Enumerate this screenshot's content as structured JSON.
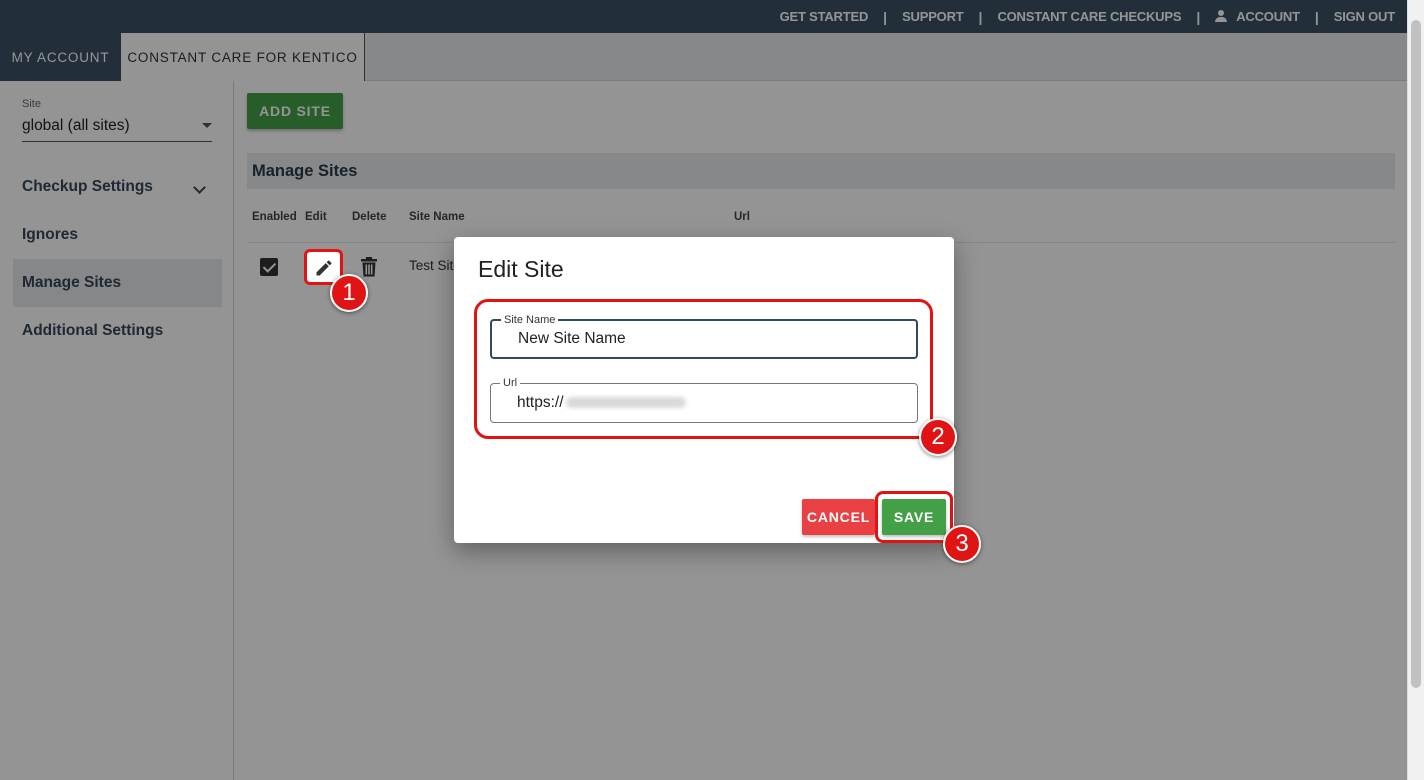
{
  "topnav": {
    "get_started": "GET STARTED",
    "support": "SUPPORT",
    "checkups": "CONSTANT CARE CHECKUPS",
    "account": "ACCOUNT",
    "sign_out": "SIGN OUT",
    "separator": "|"
  },
  "tabs": {
    "my_account": "MY ACCOUNT",
    "constant_care": "CONSTANT CARE FOR KENTICO"
  },
  "sidebar": {
    "site_label": "Site",
    "site_value": "global (all sites)",
    "items": [
      {
        "label": "Checkup Settings"
      },
      {
        "label": "Ignores"
      },
      {
        "label": "Manage Sites"
      },
      {
        "label": "Additional Settings"
      }
    ]
  },
  "main": {
    "add_site_label": "ADD SITE",
    "section_title": "Manage Sites",
    "columns": [
      "Enabled",
      "Edit",
      "Delete",
      "Site Name",
      "Url"
    ],
    "rows": [
      {
        "enabled": true,
        "site_name": "Test Site"
      }
    ]
  },
  "modal": {
    "title": "Edit Site",
    "site_name_label": "Site Name",
    "site_name_value": "New Site Name",
    "url_label": "Url",
    "url_value": "https://",
    "cancel_label": "CANCEL",
    "save_label": "SAVE"
  },
  "annotations": {
    "step1": "1",
    "step2": "2",
    "step3": "3",
    "highlight_color": "#e01414"
  },
  "colors": {
    "header_bg": "#3c5266",
    "primary_green": "#43a047",
    "cancel_red": "#e84043"
  },
  "icons": {
    "account": "user-icon",
    "edit": "pencil-icon",
    "delete": "trash-icon",
    "enabled": "checkbox-checked-icon",
    "expand": "chevron-down-icon"
  }
}
